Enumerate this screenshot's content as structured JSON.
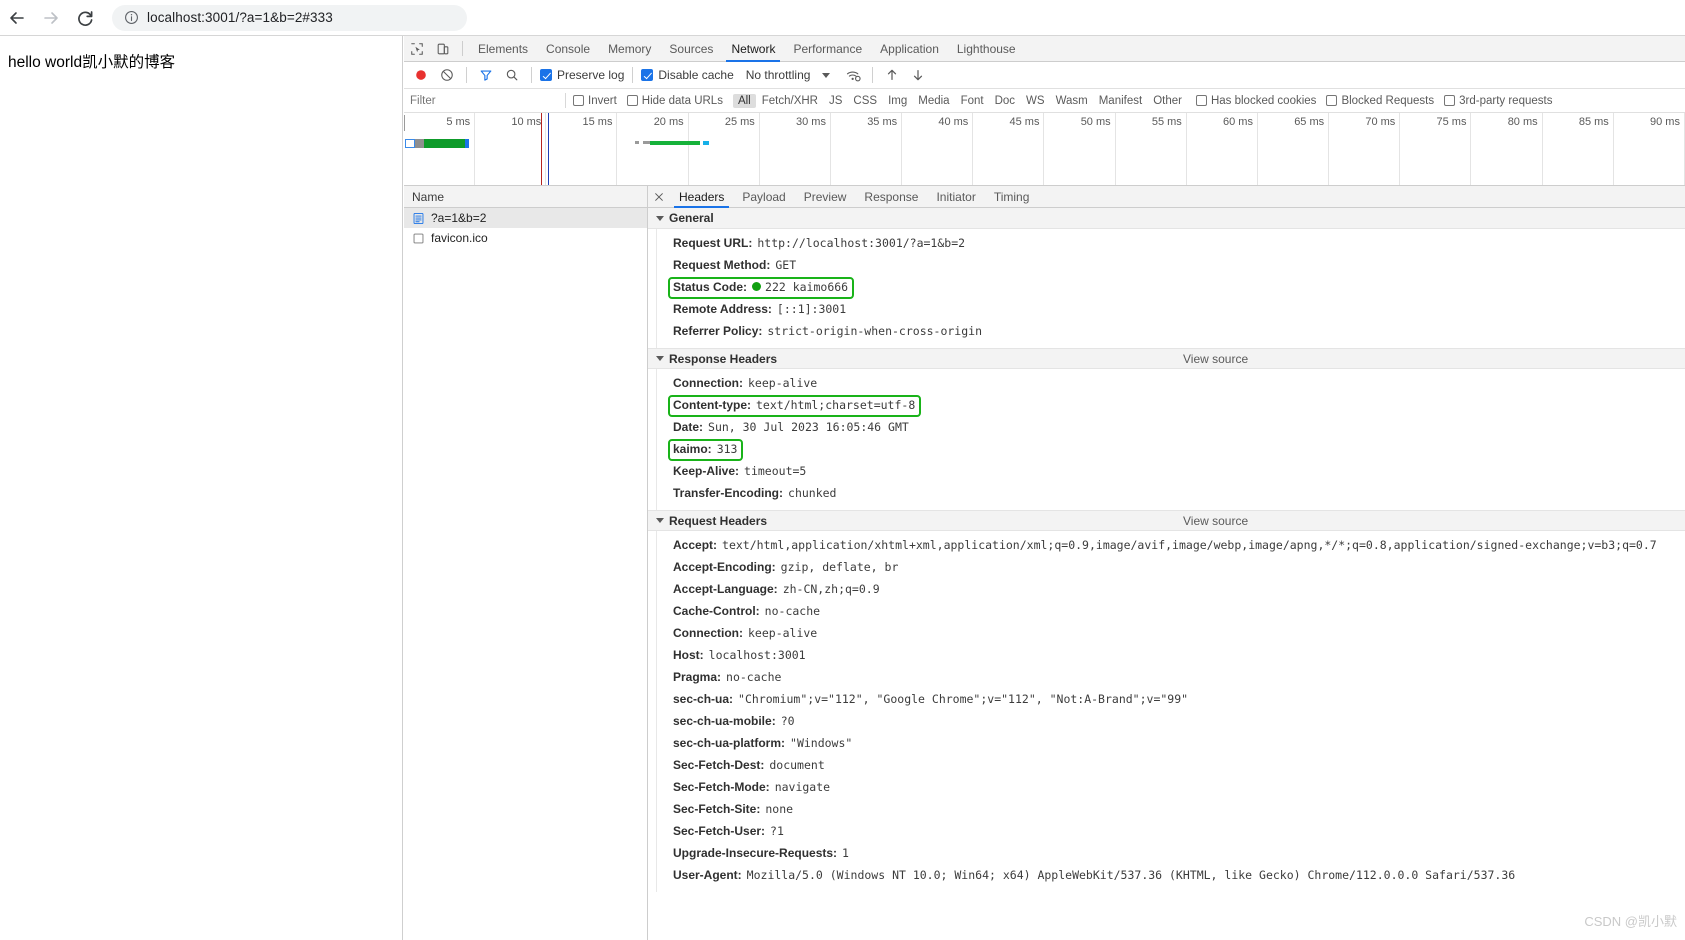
{
  "browser": {
    "back_label": "Back",
    "forward_label": "Forward",
    "reload_label": "Reload",
    "info_label": "site-information",
    "url": "localhost:3001/?a=1&b=2#333"
  },
  "page": {
    "heading": "hello world凯小默的博客"
  },
  "devtools": {
    "tabs": [
      {
        "label": "Elements",
        "active": false
      },
      {
        "label": "Console",
        "active": false
      },
      {
        "label": "Memory",
        "active": false
      },
      {
        "label": "Sources",
        "active": false
      },
      {
        "label": "Network",
        "active": true
      },
      {
        "label": "Performance",
        "active": false
      },
      {
        "label": "Application",
        "active": false
      },
      {
        "label": "Lighthouse",
        "active": false
      }
    ],
    "controls": {
      "record_label": "record",
      "clear_label": "clear",
      "filter_label": "filter",
      "search_label": "search",
      "preserve_log": "Preserve log",
      "preserve_log_checked": true,
      "disable_cache": "Disable cache",
      "disable_cache_checked": true,
      "throttling": "No throttling",
      "wifi_label": "network-conditions",
      "import_label": "import-har",
      "export_label": "export-har"
    },
    "filterbar": {
      "placeholder": "Filter",
      "invert": "Invert",
      "hide_data_urls": "Hide data URLs",
      "types": [
        "All",
        "Fetch/XHR",
        "JS",
        "CSS",
        "Img",
        "Media",
        "Font",
        "Doc",
        "WS",
        "Wasm",
        "Manifest",
        "Other"
      ],
      "selected_type": "All",
      "has_blocked_cookies": "Has blocked cookies",
      "blocked_requests": "Blocked Requests",
      "third_party": "3rd-party requests"
    },
    "timeline": {
      "ticks": [
        "5 ms",
        "10 ms",
        "15 ms",
        "20 ms",
        "25 ms",
        "30 ms",
        "35 ms",
        "40 ms",
        "45 ms",
        "50 ms",
        "55 ms",
        "60 ms",
        "65 ms",
        "70 ms",
        "75 ms",
        "80 ms",
        "85 ms",
        "90 ms"
      ]
    },
    "requests": {
      "column_name": "Name",
      "rows": [
        {
          "name": "?a=1&b=2",
          "selected": true,
          "icon": "document-icon"
        },
        {
          "name": "favicon.ico",
          "selected": false,
          "icon": "generic-file-icon"
        }
      ]
    },
    "detail_tabs": [
      {
        "label": "Headers",
        "active": true
      },
      {
        "label": "Payload",
        "active": false
      },
      {
        "label": "Preview",
        "active": false
      },
      {
        "label": "Response",
        "active": false
      },
      {
        "label": "Initiator",
        "active": false
      },
      {
        "label": "Timing",
        "active": false
      }
    ],
    "sections": {
      "general": {
        "title": "General",
        "rows": [
          {
            "name": "Request URL:",
            "value": "http://localhost:3001/?a=1&b=2",
            "highlight": false,
            "dot": false
          },
          {
            "name": "Request Method:",
            "value": "GET",
            "highlight": false,
            "dot": false
          },
          {
            "name": "Status Code:",
            "value": "222 kaimo666",
            "highlight": true,
            "dot": true
          },
          {
            "name": "Remote Address:",
            "value": "[::1]:3001",
            "highlight": false,
            "dot": false
          },
          {
            "name": "Referrer Policy:",
            "value": "strict-origin-when-cross-origin",
            "highlight": false,
            "dot": false
          }
        ]
      },
      "response_headers": {
        "title": "Response Headers",
        "view_source": "View source",
        "rows": [
          {
            "name": "Connection:",
            "value": "keep-alive",
            "highlight": false
          },
          {
            "name": "Content-type:",
            "value": "text/html;charset=utf-8",
            "highlight": true
          },
          {
            "name": "Date:",
            "value": "Sun, 30 Jul 2023 16:05:46 GMT",
            "highlight": false
          },
          {
            "name": "kaimo:",
            "value": "313",
            "highlight": true
          },
          {
            "name": "Keep-Alive:",
            "value": "timeout=5",
            "highlight": false
          },
          {
            "name": "Transfer-Encoding:",
            "value": "chunked",
            "highlight": false
          }
        ]
      },
      "request_headers": {
        "title": "Request Headers",
        "view_source": "View source",
        "rows": [
          {
            "name": "Accept:",
            "value": "text/html,application/xhtml+xml,application/xml;q=0.9,image/avif,image/webp,image/apng,*/*;q=0.8,application/signed-exchange;v=b3;q=0.7",
            "highlight": false
          },
          {
            "name": "Accept-Encoding:",
            "value": "gzip, deflate, br",
            "highlight": false
          },
          {
            "name": "Accept-Language:",
            "value": "zh-CN,zh;q=0.9",
            "highlight": false
          },
          {
            "name": "Cache-Control:",
            "value": "no-cache",
            "highlight": false
          },
          {
            "name": "Connection:",
            "value": "keep-alive",
            "highlight": false
          },
          {
            "name": "Host:",
            "value": "localhost:3001",
            "highlight": false
          },
          {
            "name": "Pragma:",
            "value": "no-cache",
            "highlight": false
          },
          {
            "name": "sec-ch-ua:",
            "value": "\"Chromium\";v=\"112\", \"Google Chrome\";v=\"112\", \"Not:A-Brand\";v=\"99\"",
            "highlight": false
          },
          {
            "name": "sec-ch-ua-mobile:",
            "value": "?0",
            "highlight": false
          },
          {
            "name": "sec-ch-ua-platform:",
            "value": "\"Windows\"",
            "highlight": false
          },
          {
            "name": "Sec-Fetch-Dest:",
            "value": "document",
            "highlight": false
          },
          {
            "name": "Sec-Fetch-Mode:",
            "value": "navigate",
            "highlight": false
          },
          {
            "name": "Sec-Fetch-Site:",
            "value": "none",
            "highlight": false
          },
          {
            "name": "Sec-Fetch-User:",
            "value": "?1",
            "highlight": false
          },
          {
            "name": "Upgrade-Insecure-Requests:",
            "value": "1",
            "highlight": false
          },
          {
            "name": "User-Agent:",
            "value": "Mozilla/5.0 (Windows NT 10.0; Win64; x64) AppleWebKit/537.36 (KHTML, like Gecko) Chrome/112.0.0.0 Safari/537.36",
            "highlight": false
          }
        ]
      }
    }
  },
  "watermark": "CSDN @凯小默",
  "colors": {
    "accent": "#1a73e8",
    "highlight_box": "#19b319",
    "status_dot": "#11a011"
  }
}
